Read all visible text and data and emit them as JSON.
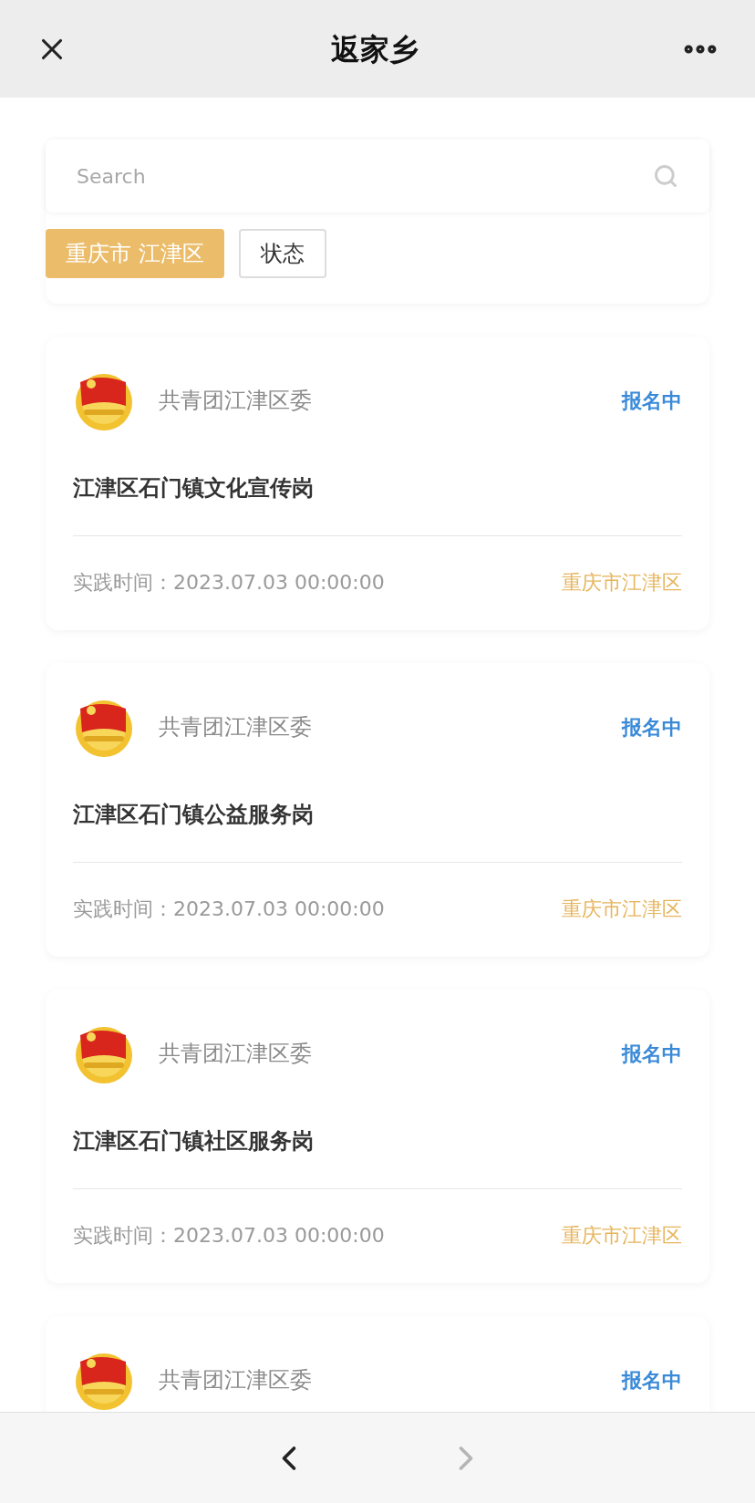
{
  "header": {
    "title": "返家乡"
  },
  "search": {
    "placeholder": "Search"
  },
  "filters": [
    {
      "label": "重庆市 江津区",
      "selected": true
    },
    {
      "label": "状态",
      "selected": false
    }
  ],
  "posts": [
    {
      "org": "共青团江津区委",
      "status": "报名中",
      "title": "江津区石门镇文化宣传岗",
      "time_label": "实践时间：",
      "time": "2023.07.03 00:00:00",
      "location": "重庆市江津区"
    },
    {
      "org": "共青团江津区委",
      "status": "报名中",
      "title": "江津区石门镇公益服务岗",
      "time_label": "实践时间：",
      "time": "2023.07.03 00:00:00",
      "location": "重庆市江津区"
    },
    {
      "org": "共青团江津区委",
      "status": "报名中",
      "title": "江津区石门镇社区服务岗",
      "time_label": "实践时间：",
      "time": "2023.07.03 00:00:00",
      "location": "重庆市江津区"
    },
    {
      "org": "共青团江津区委",
      "status": "报名中"
    }
  ],
  "nav": {
    "back": {
      "disabled": false
    },
    "forward": {
      "disabled": true
    }
  }
}
